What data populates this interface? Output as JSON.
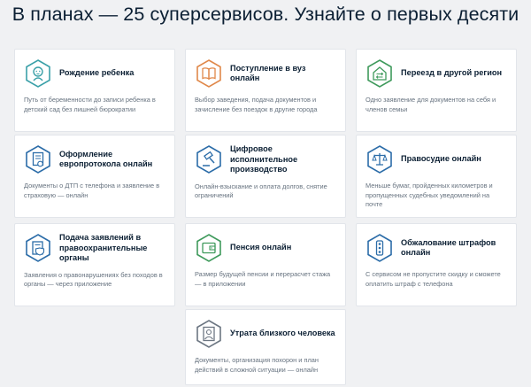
{
  "title": "В планах — 25 суперсервисов. Узнайте о первых десяти",
  "colors": {
    "teal": "#3aa0a8",
    "orange": "#e0884a",
    "green": "#3f9a5c",
    "blue": "#2b6ca8",
    "gray": "#6c7682"
  },
  "cards": [
    {
      "title": "Рождение ребенка",
      "desc": "Путь от беременности до записи ребенка в детский сад без лишней бюрократии",
      "icon": "baby-icon",
      "color": "#3aa0a8"
    },
    {
      "title": "Поступление в вуз онлайн",
      "desc": "Выбор заведения, подача документов и зачисление без поездок в другие города",
      "icon": "book-icon",
      "color": "#e0884a"
    },
    {
      "title": "Переезд в другой регион",
      "desc": "Одно заявление для документов на себя и членов семьи",
      "icon": "house-arrows-icon",
      "color": "#3f9a5c"
    },
    {
      "title": "Оформление европротокола онлайн",
      "desc": "Документы о ДТП с телефона и заявление в страховую — онлайн",
      "icon": "document-stamp-icon",
      "color": "#2b6ca8"
    },
    {
      "title": "Цифровое исполнительное производство",
      "desc": "Онлайн-взыскание и оплата долгов, снятие ограничений",
      "icon": "gavel-icon",
      "color": "#2b6ca8"
    },
    {
      "title": "Правосудие онлайн",
      "desc": "Меньше бумаг, пройденных километров и пропущенных судебных уведомлений на почте",
      "icon": "scales-icon",
      "color": "#2b6ca8"
    },
    {
      "title": "Подача заявлений в правоохранительные органы",
      "desc": "Заявления о правонарушениях без походов в органы — через приложение",
      "icon": "badge-document-icon",
      "color": "#2b6ca8"
    },
    {
      "title": "Пенсия онлайн",
      "desc": "Размер будущей пенсии и перерасчет стажа — в приложении",
      "icon": "wallet-icon",
      "color": "#3f9a5c"
    },
    {
      "title": "Обжалование штрафов онлайн",
      "desc": "С сервисом не пропустите скидку и сможете оплатить штраф с телефона",
      "icon": "traffic-light-icon",
      "color": "#2b6ca8"
    },
    {
      "title": "Утрата близкого человека",
      "desc": "Документы, организация похорон и план действий в сложной ситуации — онлайн",
      "icon": "portrait-icon",
      "color": "#6c7682"
    }
  ]
}
